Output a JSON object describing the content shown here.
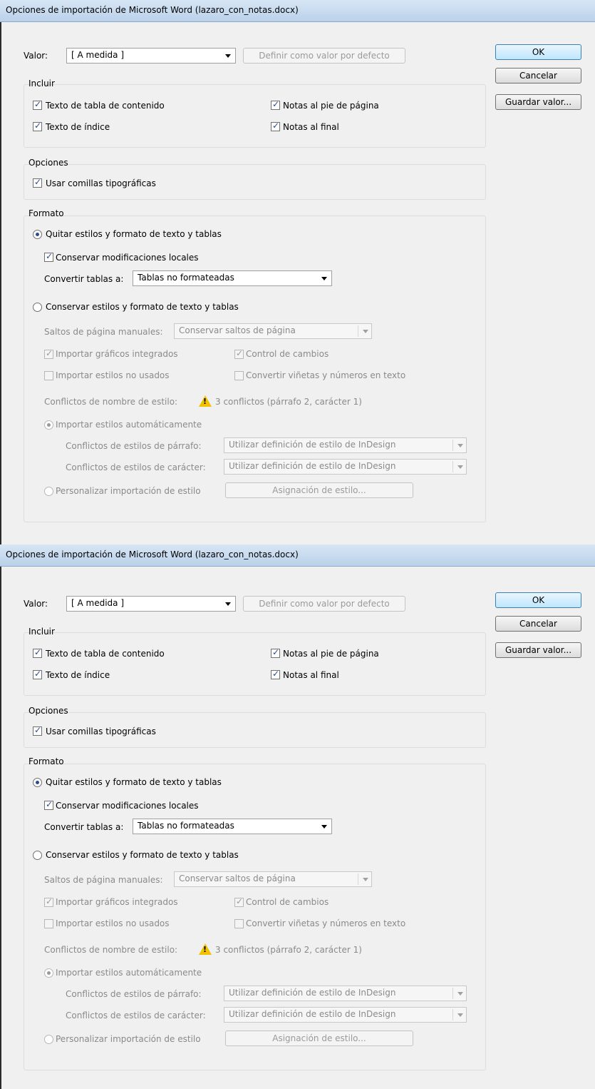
{
  "title": "Opciones de importación de Microsoft Word (lazaro_con_notas.docx)",
  "preset_label": "Valor:",
  "preset_value": "[ A medida ]",
  "set_default_label": "Definir como valor por defecto",
  "ok_label": "OK",
  "cancel_label": "Cancelar",
  "save_preset_label": "Guardar valor...",
  "include": {
    "heading": "Incluir",
    "toc": "Texto de tabla de contenido",
    "index": "Texto de índice",
    "footnotes": "Notas al pie de página",
    "endnotes": "Notas al final"
  },
  "options": {
    "heading": "Opciones",
    "smart_quotes": "Usar comillas tipográficas"
  },
  "format": {
    "heading": "Formato",
    "remove_styles": "Quitar estilos y formato de texto y tablas",
    "preserve_local": "Conservar modificaciones locales",
    "convert_tables_label": "Convertir tablas a:",
    "convert_tables_value": "Tablas no formateadas",
    "preserve_styles": "Conservar estilos y formato de texto y tablas",
    "page_breaks_label": "Saltos de página manuales:",
    "page_breaks_value": "Conservar saltos de página",
    "inline_graphics": "Importar gráficos integrados",
    "track_changes": "Control de cambios",
    "unused_styles": "Importar estilos no usados",
    "convert_bullets": "Convertir viñetas y números en texto",
    "conflicts_label": "Conflictos de nombre de estilo:",
    "conflicts_value": "3 conflictos (párrafo 2, carácter 1)",
    "auto_import": "Importar estilos automáticamente",
    "para_conflicts_label": "Conflictos de estilos de párrafo:",
    "para_conflicts_value": "Utilizar definición de estilo de InDesign",
    "char_conflicts_label": "Conflictos de estilos de carácter:",
    "char_conflicts_value": "Utilizar definición de estilo de InDesign",
    "customize_import": "Personalizar importación de estilo",
    "style_mapping": "Asignación de estilo..."
  },
  "states": {
    "toc": true,
    "index": true,
    "footnotes": true,
    "endnotes": true,
    "smart_quotes": true,
    "remove_styles": true,
    "preserve_local": true,
    "preserve_styles": false,
    "inline_graphics": true,
    "track_changes": true,
    "unused_styles": false,
    "convert_bullets": false,
    "auto_import": true,
    "customize_import": false
  },
  "icons": {
    "warning": "warning-icon"
  }
}
